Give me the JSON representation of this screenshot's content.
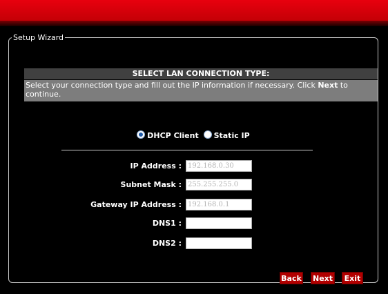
{
  "wizard": {
    "legend": "Setup Wizard",
    "section_title": "SELECT LAN CONNECTION TYPE:",
    "instructions_pre": "Select your connection type and fill out the IP information if necessary. Click ",
    "instructions_bold": "Next",
    "instructions_post": " to continue."
  },
  "connection_type": {
    "dhcp_label": "DHCP Client",
    "static_label": "Static IP",
    "selected": "DHCP Client"
  },
  "fields": {
    "ip_address": {
      "label": "IP Address :",
      "value": "192.168.0.30"
    },
    "subnet_mask": {
      "label": "Subnet Mask :",
      "value": "255.255.255.0"
    },
    "gateway": {
      "label": "Gateway IP Address :",
      "value": "192.168.0.1"
    },
    "dns1": {
      "label": "DNS1 :",
      "value": ""
    },
    "dns2": {
      "label": "DNS2 :",
      "value": ""
    }
  },
  "buttons": {
    "back": "Back",
    "next": "Next",
    "exit": "Exit"
  },
  "colors": {
    "top_bar": "#d4000a",
    "section_header": "#404040",
    "instruction_bg": "#7d7d7d",
    "button": "#b10000",
    "radio_selected": "#1e5aa8"
  }
}
